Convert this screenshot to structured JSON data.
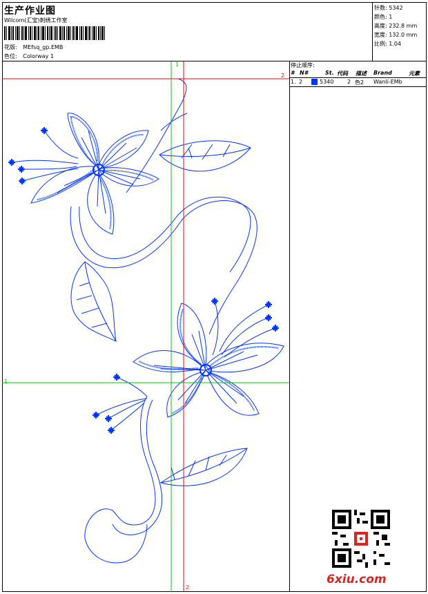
{
  "header": {
    "title": "生产作业图",
    "subtitle": "Wilcom(汇宝)刺绣工作室",
    "design_label": "花版:",
    "design_file": "MEfsq_gp.EMB",
    "colorway_label": "色位:",
    "colorway": "Colorway 1"
  },
  "stats": {
    "stitches": "针数: 5342",
    "colors": "颜色: 1",
    "height": "高度: 232.8 mm",
    "width": "宽度: 132.0 mm",
    "scale": "比例: 1.04"
  },
  "stop_sequence": {
    "title": "停止顺序:",
    "columns": [
      "#",
      "N#",
      "St.",
      "代码",
      "描述",
      "Brand",
      "元素"
    ],
    "rows": [
      {
        "index": "1.",
        "needle": "2",
        "stitches": "5340",
        "code": "2",
        "description": "色2",
        "brand": "Wanli-EMb",
        "element": ""
      }
    ]
  },
  "guides": {
    "v1": "1",
    "v2_top": "2",
    "v2_bottom": "2",
    "h1": "1",
    "h2": "2"
  },
  "watermark": {
    "text": "6xiu.com"
  },
  "colors": {
    "thread": "#0033ff",
    "guide_green": "#00cc00",
    "guide_red": "#ff0000",
    "watermark": "#e0221c"
  }
}
